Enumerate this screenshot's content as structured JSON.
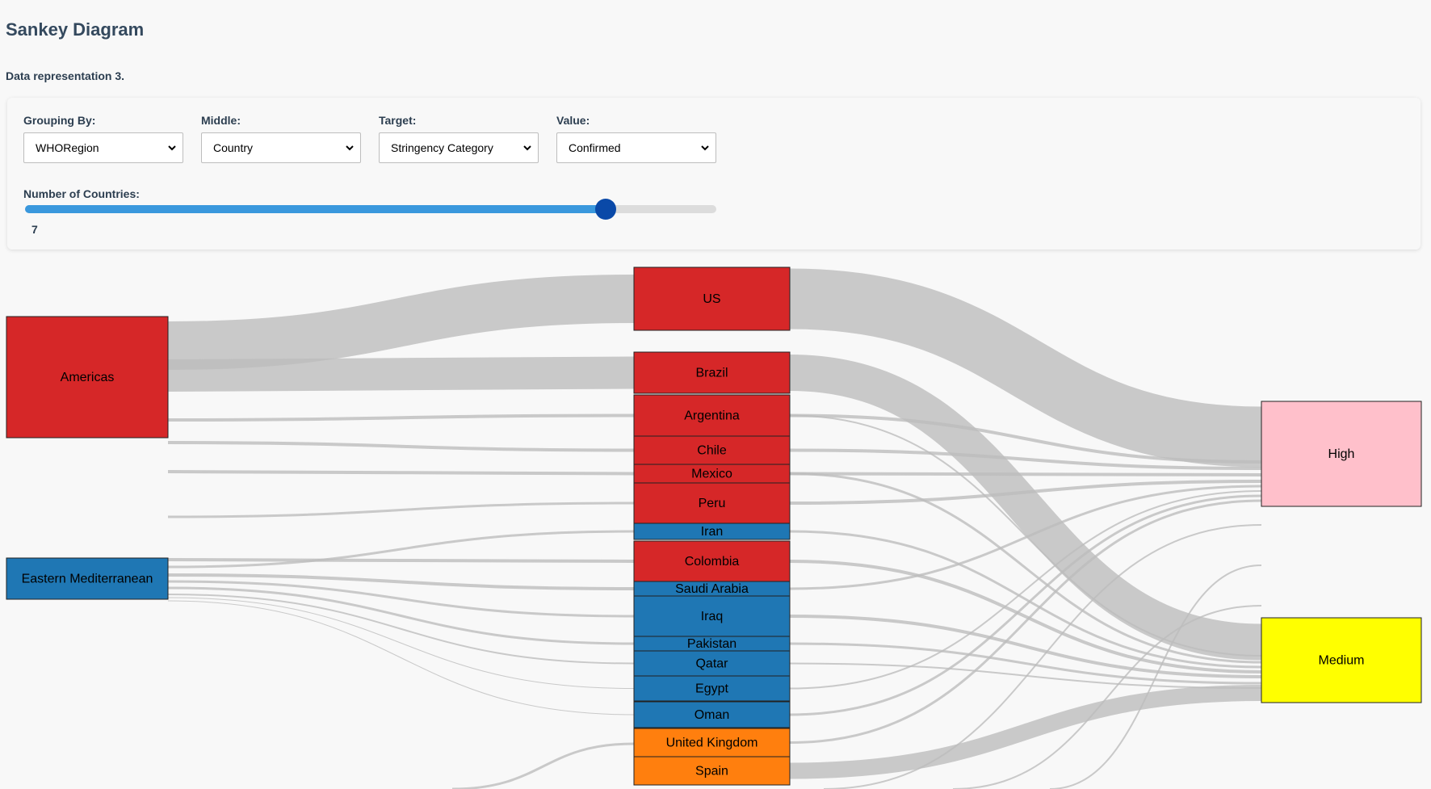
{
  "header": {
    "title": "Sankey Diagram",
    "subtitle": "Data representation 3."
  },
  "controls": {
    "grouping": {
      "label": "Grouping By:",
      "value": "WHORegion"
    },
    "middle": {
      "label": "Middle:",
      "value": "Country"
    },
    "target": {
      "label": "Target:",
      "value": "Stringency Category"
    },
    "value": {
      "label": "Value:",
      "value": "Confirmed"
    },
    "countries": {
      "label": "Number of Countries:",
      "value": "7",
      "fraction": 0.84
    }
  },
  "colors": {
    "americas": "#d62728",
    "eastern_mediterranean": "#1f77b4",
    "europe": "#ff7f0e",
    "high": "#ffc0cb",
    "medium": "#ffff00",
    "link": "#bdbdbd"
  },
  "chart_data": {
    "type": "sankey",
    "title": "",
    "sources": [
      {
        "name": "Americas",
        "color": "#d62728"
      },
      {
        "name": "Eastern Mediterranean",
        "color": "#1f77b4"
      }
    ],
    "middle": [
      {
        "name": "US",
        "color": "#d62728"
      },
      {
        "name": "Brazil",
        "color": "#d62728"
      },
      {
        "name": "Argentina",
        "color": "#d62728"
      },
      {
        "name": "Chile",
        "color": "#d62728"
      },
      {
        "name": "Mexico",
        "color": "#d62728"
      },
      {
        "name": "Peru",
        "color": "#d62728"
      },
      {
        "name": "Iran",
        "color": "#1f77b4"
      },
      {
        "name": "Colombia",
        "color": "#d62728"
      },
      {
        "name": "Saudi Arabia",
        "color": "#1f77b4"
      },
      {
        "name": "Iraq",
        "color": "#1f77b4"
      },
      {
        "name": "Pakistan",
        "color": "#1f77b4"
      },
      {
        "name": "Qatar",
        "color": "#1f77b4"
      },
      {
        "name": "Egypt",
        "color": "#1f77b4"
      },
      {
        "name": "Oman",
        "color": "#1f77b4"
      },
      {
        "name": "United Kingdom",
        "color": "#ff7f0e"
      },
      {
        "name": "Spain",
        "color": "#ff7f0e"
      }
    ],
    "targets": [
      {
        "name": "High",
        "color": "#ffc0cb"
      },
      {
        "name": "Medium",
        "color": "#ffff00"
      }
    ]
  }
}
